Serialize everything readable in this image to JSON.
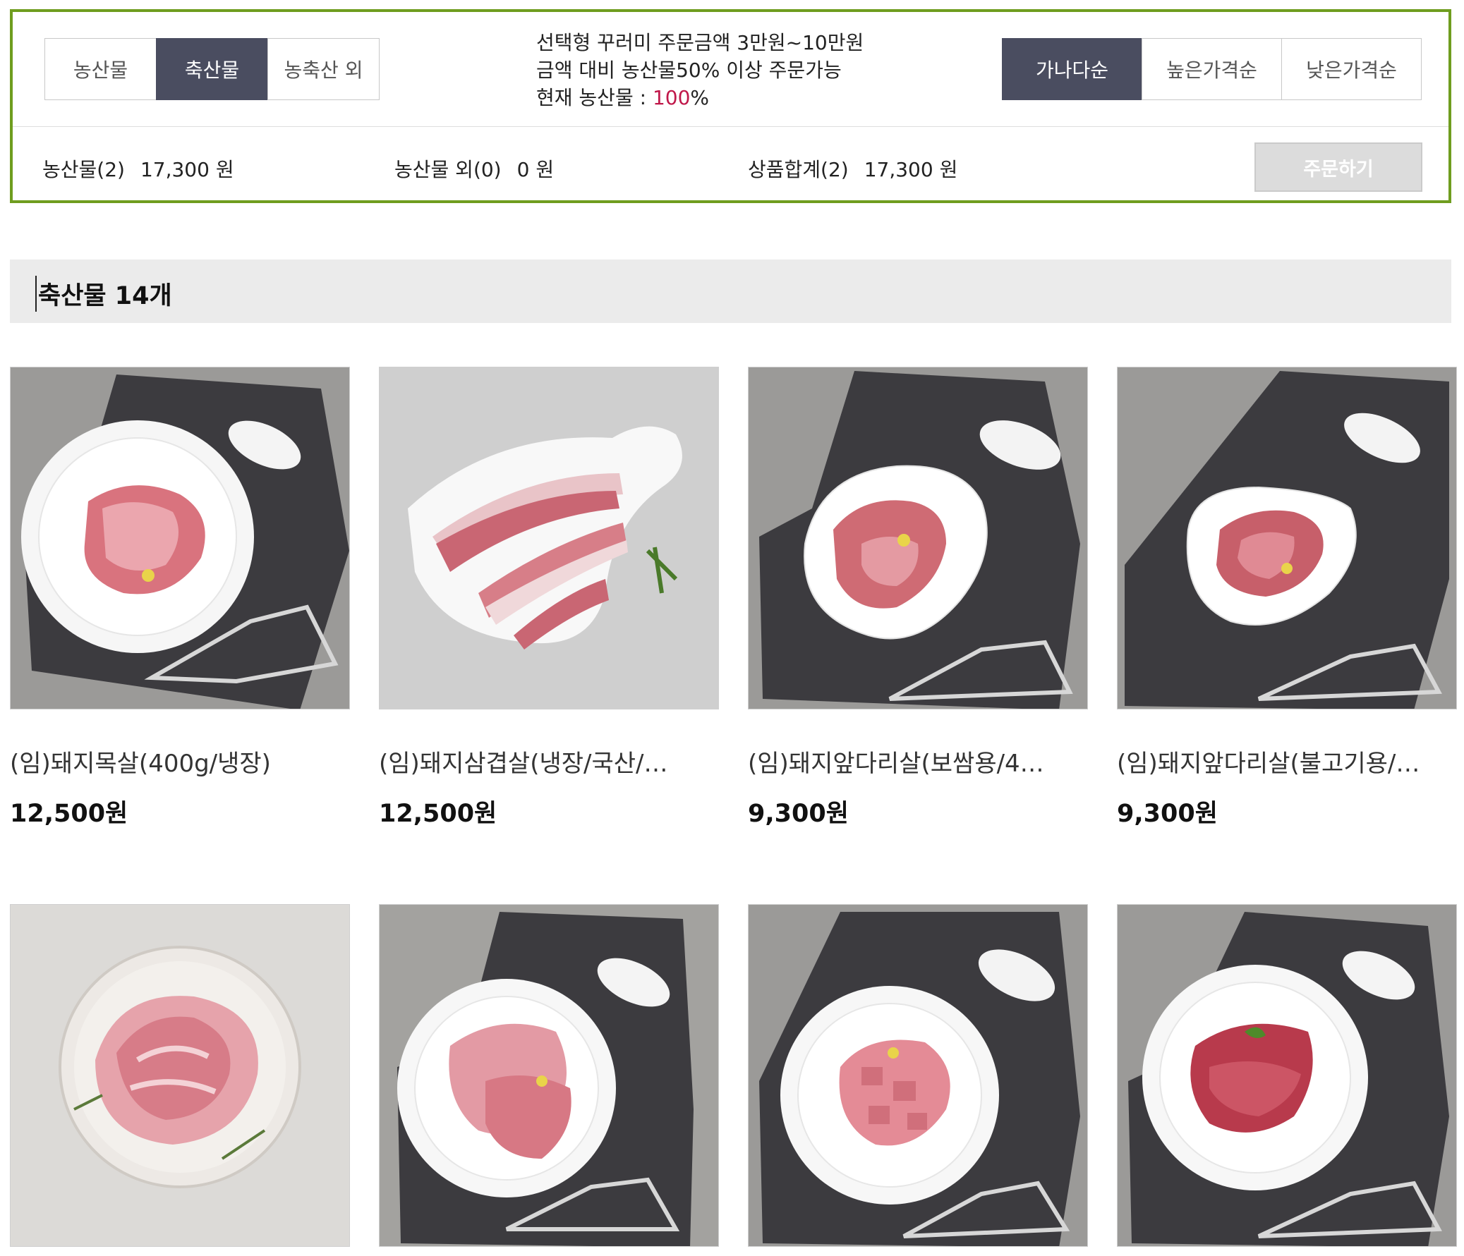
{
  "category_tabs": [
    "농산물",
    "축산물",
    "농축산 외"
  ],
  "notice": {
    "line1": "선택형 꾸러미 주문금액 3만원~10만원",
    "line2": "금액 대비 농산물50% 이상 주문가능",
    "line3_prefix": "현재 농산물 : ",
    "line3_value": "100",
    "line3_suffix": "%"
  },
  "sort_options": [
    "가나다순",
    "높은가격순",
    "낮은가격순"
  ],
  "summary": {
    "farm_label": "농산물(2)",
    "farm_amount": "17,300 원",
    "other_label": "농산물 외(0)",
    "other_amount": "0 원",
    "total_label": "상품합계(2)",
    "total_amount": "17,300 원",
    "order_button": "주문하기"
  },
  "section": {
    "title": "축산물 14개"
  },
  "products": [
    {
      "name": "(임)돼지목살(400g/냉장)",
      "price": "12,500원"
    },
    {
      "name": "(임)돼지삼겹살(냉장/국산/…",
      "price": "12,500원"
    },
    {
      "name": "(임)돼지앞다리살(보쌈용/4…",
      "price": "9,300원"
    },
    {
      "name": "(임)돼지앞다리살(불고기용/…",
      "price": "9,300원"
    },
    {
      "name": "",
      "price": ""
    },
    {
      "name": "",
      "price": ""
    },
    {
      "name": "",
      "price": ""
    },
    {
      "name": "",
      "price": ""
    }
  ],
  "colors": {
    "panel_border": "#6f9d1f",
    "active_tab": "#4a4d60",
    "highlight": "#c0184a",
    "section_bg": "#ebebeb"
  }
}
